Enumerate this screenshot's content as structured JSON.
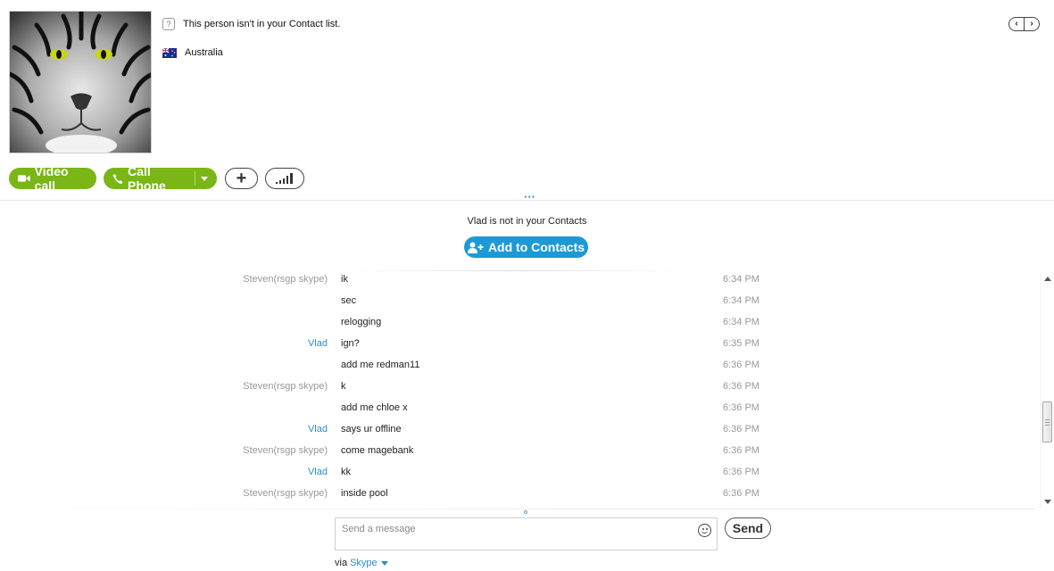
{
  "profile": {
    "not_in_contact_list": "This person isn't in your Contact list.",
    "country": "Australia",
    "avatar_icon": "tiger-avatar",
    "nav_prev": "‹",
    "nav_next": "›"
  },
  "actions": {
    "video_call": "Video call",
    "call_phone": "Call Phone",
    "add_label": "+"
  },
  "notice": {
    "text": "Vlad is not in your Contacts",
    "add_to_contacts": "Add to Contacts"
  },
  "chat": {
    "messages": [
      {
        "sender": "Steven(rsgp skype)",
        "text": "ik",
        "time": "6:34 PM"
      },
      {
        "sender": "",
        "text": "sec",
        "time": "6:34 PM"
      },
      {
        "sender": "",
        "text": "relogging",
        "time": "6:34 PM"
      },
      {
        "sender": "Vlad",
        "text": "ign?",
        "time": "6:35 PM"
      },
      {
        "sender": "",
        "text": "add me redman11",
        "time": "6:36 PM"
      },
      {
        "sender": "Steven(rsgp skype)",
        "text": "k",
        "time": "6:36 PM"
      },
      {
        "sender": "",
        "text": "add me chloe x",
        "time": "6:36 PM"
      },
      {
        "sender": "Vlad",
        "text": "says ur offline",
        "time": "6:36 PM"
      },
      {
        "sender": "Steven(rsgp skype)",
        "text": "come magebank",
        "time": "6:36 PM"
      },
      {
        "sender": "Vlad",
        "text": "kk",
        "time": "6:36 PM"
      },
      {
        "sender": "Steven(rsgp skype)",
        "text": "inside pool",
        "time": "6:36 PM"
      }
    ]
  },
  "composer": {
    "placeholder": "Send a message",
    "value": "",
    "send_label": "Send",
    "via_prefix": "via",
    "via_service": "Skype"
  },
  "colors": {
    "green": "#79b616",
    "blue": "#1c9ad6",
    "link_blue": "#2a8dd4"
  }
}
